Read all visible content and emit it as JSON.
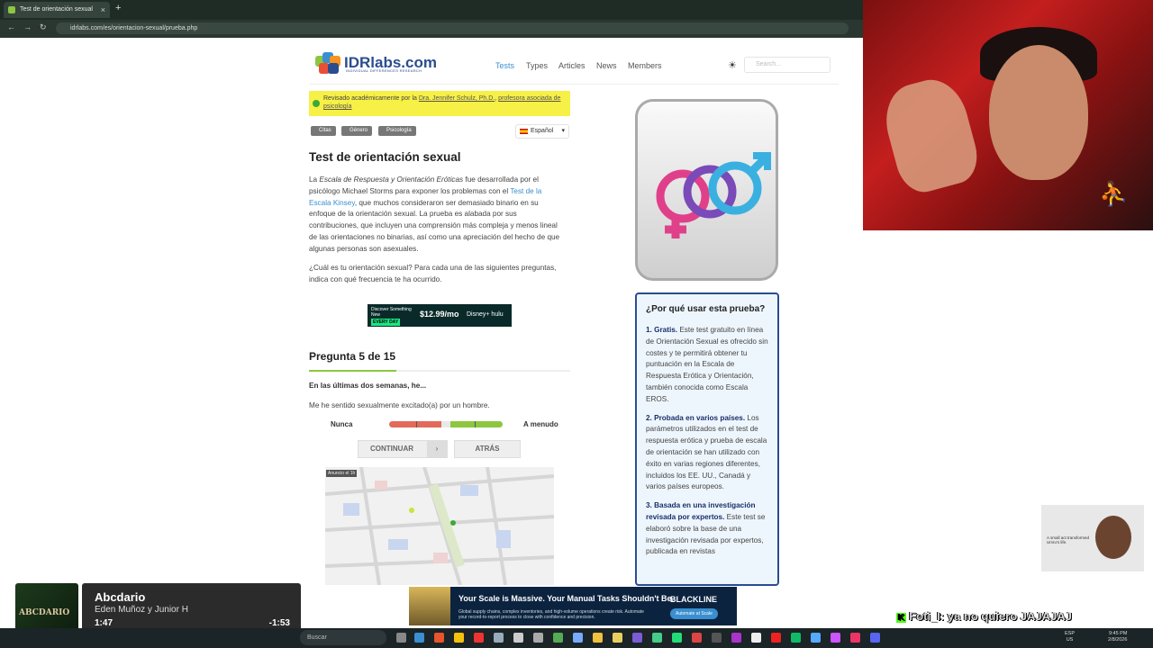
{
  "browser": {
    "tab_title": "Test de orientación sexual",
    "tab_close": "×",
    "new_tab": "+",
    "back": "←",
    "forward": "→",
    "reload": "↻",
    "url": "idrlabs.com/es/orientacion-sexual/prueba.php"
  },
  "site": {
    "logo": "IDRlabs.com",
    "logo_sub": "INDIVIDUAL DIFFERENCES RESEARCH",
    "nav": [
      "Tests",
      "Types",
      "Articles",
      "News",
      "Members"
    ],
    "search_placeholder": "Search...",
    "theme_icon": "☀"
  },
  "review": {
    "text": "Revisado académicamente por la ",
    "author": "Dra. Jennifer Schulz, Ph.D.",
    "sep": ", ",
    "role": "profesora asociada de psicología"
  },
  "tags": [
    "Citas",
    "Género",
    "Psicología"
  ],
  "language": "Español",
  "article": {
    "title": "Test de orientación sexual",
    "p1_a": "La ",
    "p1_italic": "Escala de Respuesta y Orientación Eróticas",
    "p1_b": " fue desarrollada por el psicólogo Michael Storms para exponer los problemas con el ",
    "p1_link": "Test de la Escala Kinsey",
    "p1_c": ", que muchos consideraron ser demasiado binario en su enfoque de la orientación sexual. La prueba es alabada por sus contribuciones, que incluyen una comprensión más compleja y menos lineal de las orientaciones no binarias, así como una apreciación del hecho de que algunas personas son asexuales.",
    "p2": "¿Cuál es tu orientación sexual? Para cada una de las siguientes preguntas, indica con qué frecuencia te ha ocurrido."
  },
  "ad": {
    "left_text": "Discover Something New",
    "every_day": "EVERY DAY",
    "price": "$12.99/mo",
    "brand": "Disney+ hulu"
  },
  "question": {
    "title": "Pregunta 5 de 15",
    "progress": 0.333,
    "lead": "En las últimas dos semanas, he...",
    "text": "Me he sentido sexualmente excitado(a) por un hombre.",
    "low_label": "Nunca",
    "high_label": "A menudo",
    "continue": "CONTINUAR",
    "continue_arrow": "›",
    "back": "ATRÁS"
  },
  "map": {
    "label": "Anuncio el 1h"
  },
  "why": {
    "title": "¿Por qué usar esta prueba?",
    "items": [
      {
        "bold": "1. Gratis.",
        "text": " Este test gratuito en línea de Orientación Sexual es ofrecido sin costes y te permitirá obtener tu puntuación en la Escala de Respuesta Erótica y Orientación, también conocida como Escala EROS."
      },
      {
        "bold": "2. Probada en varios países.",
        "text": " Los parámetros utilizados en el test de respuesta erótica y prueba de escala de orientación se han utilizado con éxito en varias regiones diferentes, incluidos los EE. UU., Canadá y varios países europeos."
      },
      {
        "bold": "3. Basada en una investigación revisada por expertos.",
        "text": " Este test se elaboró sobre la base de una investigación revisada por expertos, publicada en revistas"
      }
    ]
  },
  "pip": {
    "text": "A small act transformed Umru's life."
  },
  "spotify": {
    "album_text": "ABCDARIO",
    "song": "Abcdario",
    "artist": "Eden Muñoz y Junior H",
    "elapsed": "1:47",
    "remaining": "-1:53",
    "progress": 0.48
  },
  "bottom_ad": {
    "headline": "Your Scale is Massive. Your Manual Tasks Shouldn't Be.",
    "sub": "Global supply chains, complex inventories, and high-volume operations create risk. Automate your record-to-report process to close with confidence and precision.",
    "brand": "BLACKLINE",
    "cta": "Automate at Scale"
  },
  "chat": {
    "badge": "K",
    "user": "Foti_I",
    "message": ": ya no quiero JAJAJAJ"
  },
  "taskbar": {
    "search": "Buscar",
    "lang_top": "ESP",
    "lang_bottom": "US",
    "time": "9:45 PM",
    "date": "2/8/2026"
  },
  "webcam": {
    "jordan_logo": "⛹"
  },
  "colors": {
    "accent": "#3a8fd0",
    "brand": "#2a4d8f",
    "green": "#8dc63f",
    "review_bg": "#f7f046"
  }
}
